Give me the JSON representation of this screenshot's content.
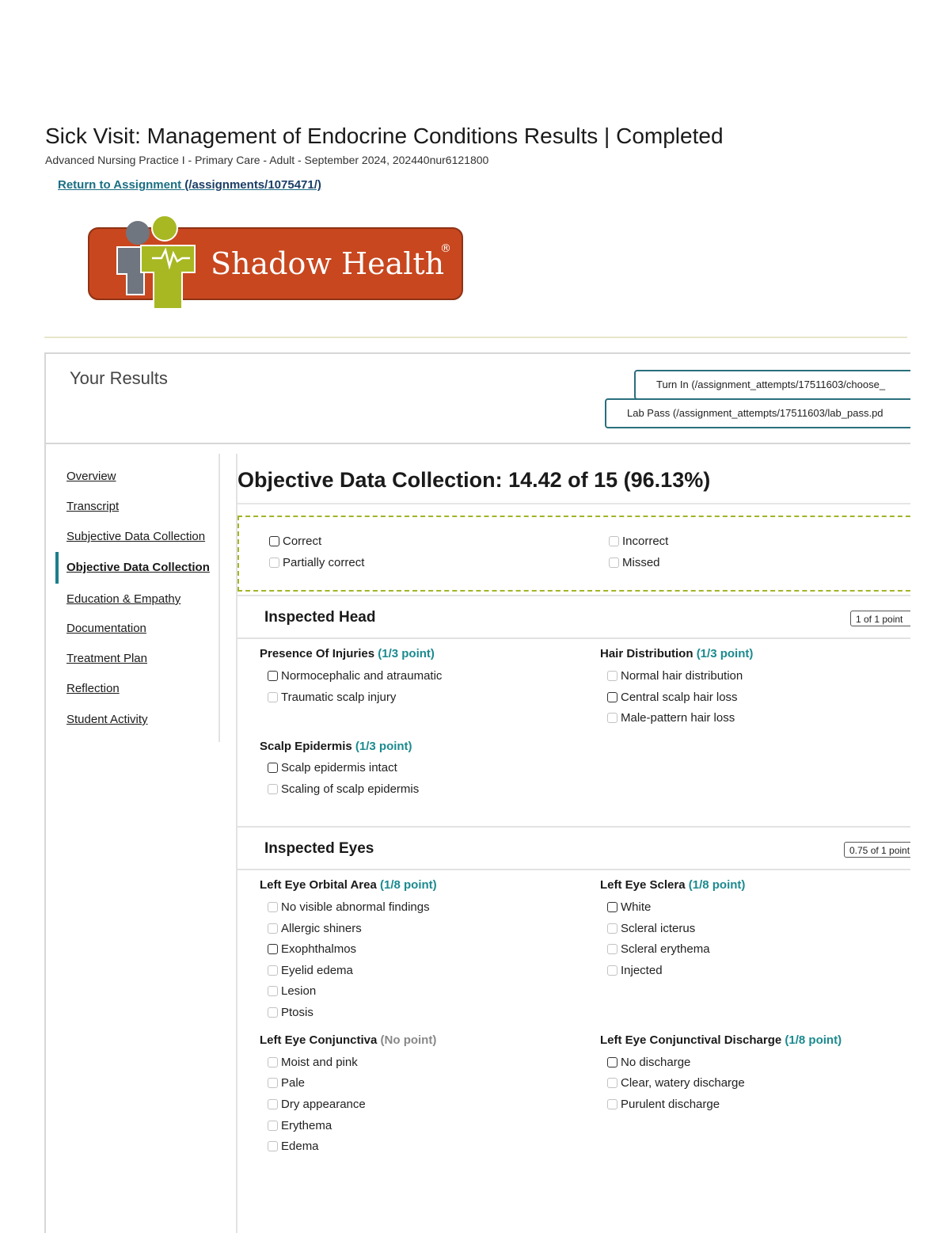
{
  "page": {
    "title": "Sick Visit: Management of Endocrine Conditions Results | Completed",
    "subtitle": "Advanced Nursing Practice I - Primary Care - Adult - September 2024, 202440nur6121800",
    "return_link_text": "Return to Assignment",
    "return_link_path": " (/assignments/1075471/)"
  },
  "logo": {
    "text": "Shadow Health",
    "mark": "®",
    "brand_color": "#c8471f",
    "accent_color": "#a8b823"
  },
  "results": {
    "heading": "Your Results",
    "turn_in_label": "Turn In (/assignment_attempts/17511603/choose_",
    "lab_pass_label": "Lab Pass (/assignment_attempts/17511603/lab_pass.pd"
  },
  "nav": {
    "items": [
      "Overview",
      "Transcript",
      "Subjective Data Collection",
      "Objective Data Collection",
      "Education & Empathy",
      "Documentation",
      "Treatment Plan",
      "Reflection",
      "Student Activity"
    ],
    "active_index": 3
  },
  "section": {
    "title": "Objective Data Collection: 14.42 of 15 (96.13%)"
  },
  "legend": {
    "correct": "Correct",
    "partially_correct": "Partially correct",
    "incorrect": "Incorrect",
    "missed": "Missed"
  },
  "head": {
    "title": "Inspected Head",
    "score": "1 of 1 point",
    "injuries": {
      "label": "Presence Of Injuries",
      "points": "(1/3 point)",
      "options": [
        "Normocephalic and atraumatic",
        "Traumatic scalp injury"
      ]
    },
    "hair": {
      "label": "Hair Distribution",
      "points": "(1/3 point)",
      "options": [
        "Normal hair distribution",
        "Central scalp hair loss",
        "Male-pattern hair loss"
      ]
    },
    "scalp": {
      "label": "Scalp Epidermis",
      "points": "(1/3 point)",
      "options": [
        "Scalp epidermis intact",
        "Scaling of scalp epidermis"
      ]
    }
  },
  "eyes": {
    "title": "Inspected Eyes",
    "score": "0.75 of 1 point",
    "orbital": {
      "label": "Left Eye Orbital Area",
      "points": "(1/8 point)",
      "options": [
        "No visible abnormal findings",
        "Allergic shiners",
        "Exophthalmos",
        "Eyelid edema",
        "Lesion",
        "Ptosis"
      ]
    },
    "sclera": {
      "label": "Left Eye Sclera",
      "points": "(1/8 point)",
      "options": [
        "White",
        "Scleral icterus",
        "Scleral erythema",
        "Injected"
      ]
    },
    "conjunctiva": {
      "label": "Left Eye Conjunctiva",
      "points": "(No point)",
      "options": [
        "Moist and pink",
        "Pale",
        "Dry appearance",
        "Erythema",
        "Edema"
      ]
    },
    "discharge": {
      "label": "Left Eye Conjunctival Discharge",
      "points": "(1/8 point)",
      "options": [
        "No discharge",
        "Clear, watery discharge",
        "Purulent discharge"
      ]
    }
  }
}
